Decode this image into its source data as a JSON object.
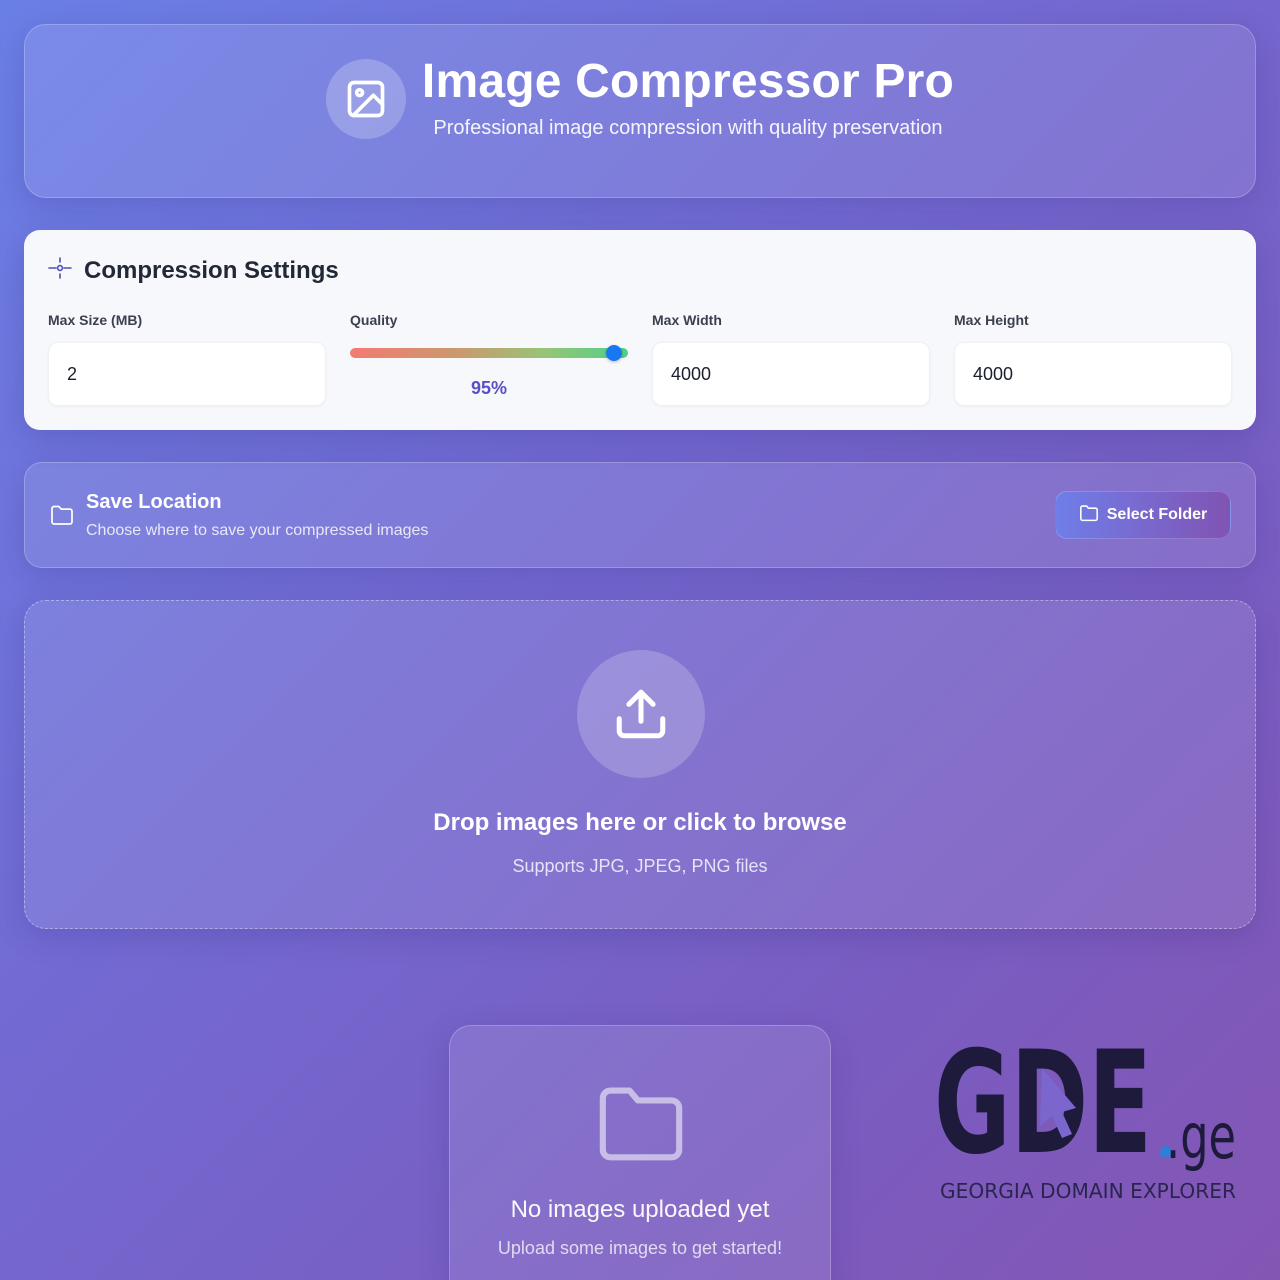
{
  "header": {
    "title": "Image Compressor Pro",
    "subtitle": "Professional image compression with quality preservation",
    "icon": "image-icon"
  },
  "settings": {
    "title": "Compression Settings",
    "icon": "crosshair-settings-icon",
    "max_size": {
      "label": "Max Size (MB)",
      "value": "2"
    },
    "quality": {
      "label": "Quality",
      "value": 95,
      "display": "95%"
    },
    "max_width": {
      "label": "Max Width",
      "value": "4000"
    },
    "max_height": {
      "label": "Max Height",
      "value": "4000"
    }
  },
  "save_location": {
    "title": "Save Location",
    "description": "Choose where to save your compressed images",
    "button_label": "Select Folder",
    "icon": "folder-icon"
  },
  "dropzone": {
    "title": "Drop images here or click to browse",
    "subtitle": "Supports JPG, JPEG, PNG files",
    "icon": "upload-icon"
  },
  "empty_state": {
    "title": "No images uploaded yet",
    "subtitle": "Upload some images to get started!",
    "icon": "folder-icon"
  },
  "watermark": {
    "brand": "GDE",
    "suffix": ".ge",
    "tagline": "GEORGIA DOMAIN EXPLORER"
  },
  "colors": {
    "accent": "#5a4fc4",
    "slider_thumb": "#1778f2",
    "logo_dark": "#1e1a3c",
    "logo_dot": "#2f7fd8"
  }
}
